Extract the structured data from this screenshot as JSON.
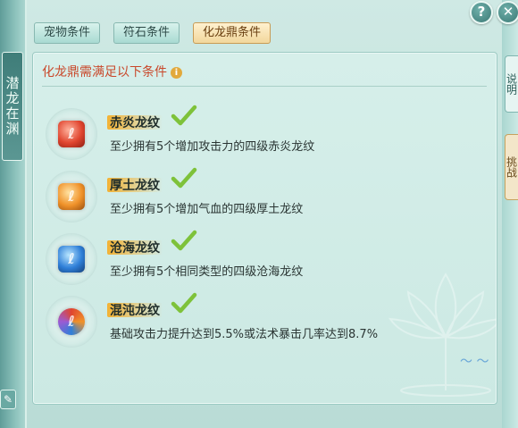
{
  "left_banner": {
    "text": "潜龙在渊"
  },
  "right_tabs": [
    {
      "label": "说明"
    },
    {
      "label": "挑战"
    }
  ],
  "buttons": {
    "help": "?",
    "close": "✕",
    "edit": "✎"
  },
  "tabs": [
    {
      "label": "宠物条件",
      "active": false
    },
    {
      "label": "符石条件",
      "active": false
    },
    {
      "label": "化龙鼎条件",
      "active": true
    }
  ],
  "panel": {
    "header": "化龙鼎需满足以下条件",
    "info_icon": "i"
  },
  "conditions": [
    {
      "name": "赤炎龙纹",
      "desc": "至少拥有5个增加攻击力的四级赤炎龙纹",
      "met": true,
      "icon": "red-gem-icon",
      "color": "#e0452f"
    },
    {
      "name": "厚土龙纹",
      "desc": "至少拥有5个增加气血的四级厚土龙纹",
      "met": true,
      "icon": "orange-gem-icon",
      "color": "#f0922a"
    },
    {
      "name": "沧海龙纹",
      "desc": "至少拥有5个相同类型的四级沧海龙纹",
      "met": true,
      "icon": "blue-gem-icon",
      "color": "#2f7fd8"
    },
    {
      "name": "混沌龙纹",
      "desc": "基础攻击力提升达到5.5%或法术暴击几率达到8.7%",
      "met": true,
      "icon": "chaos-gem-icon",
      "color": "#9b5bd4"
    }
  ],
  "colors": {
    "accent_red": "#c9482b",
    "check_green": "#7ec23a",
    "tab_active": "#f2d79c"
  }
}
